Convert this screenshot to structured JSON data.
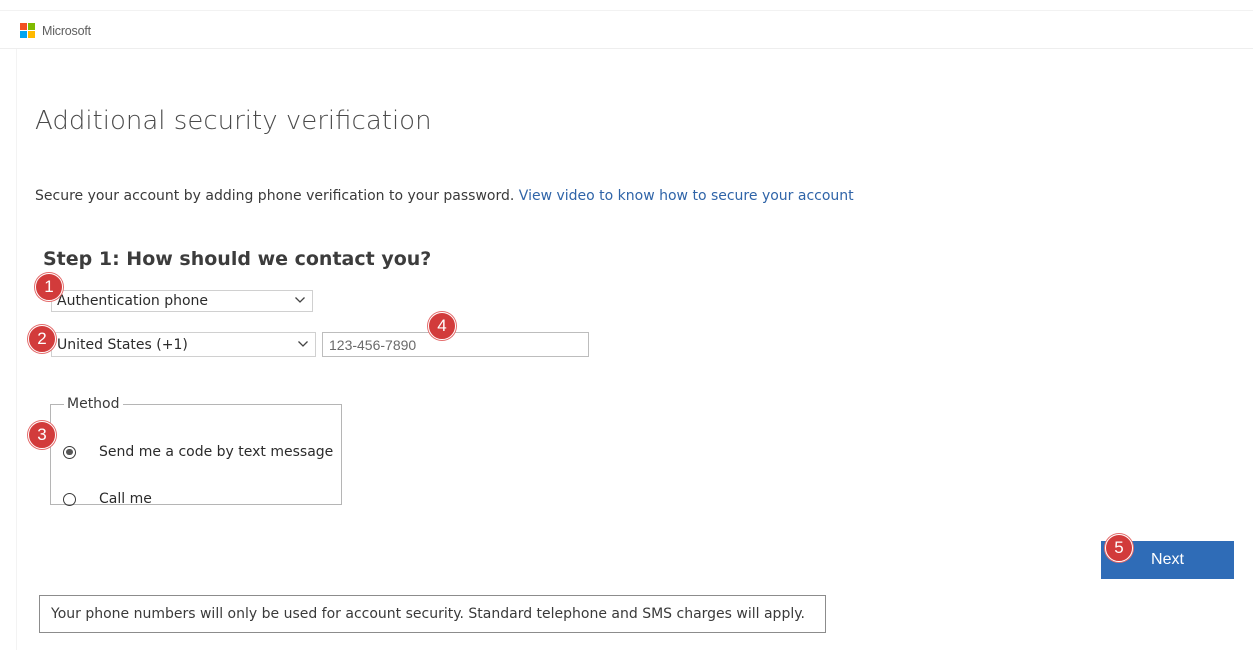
{
  "header": {
    "brand_name": "Microsoft",
    "logo_colors": [
      "#f25022",
      "#7fba00",
      "#00a4ef",
      "#ffb900"
    ]
  },
  "page": {
    "title": "Additional security verification",
    "intro_text": "Secure your account by adding phone verification to your password.",
    "intro_link": "View video to know how to secure your account"
  },
  "step1": {
    "title": "Step 1: How should we contact you?",
    "contact_method_value": "Authentication phone",
    "country_value": "United States (+1)",
    "phone_placeholder": "123-456-7890"
  },
  "method": {
    "legend": "Method",
    "options": [
      {
        "label": "Send me a code by text message",
        "selected": true
      },
      {
        "label": "Call me",
        "selected": false
      }
    ]
  },
  "actions": {
    "next_label": "Next"
  },
  "footer": {
    "note": "Your phone numbers will only be used for account security. Standard telephone and SMS charges will apply."
  },
  "markers": [
    "1",
    "2",
    "3",
    "4",
    "5"
  ],
  "colors": {
    "accent": "#2f6cb7",
    "link": "#2f64a8",
    "marker": "#d23b3b"
  },
  "icons": {
    "dropdown": "chevron-down-icon",
    "radio_selected": "radio-checked-icon",
    "radio_unselected": "radio-unchecked-icon"
  }
}
